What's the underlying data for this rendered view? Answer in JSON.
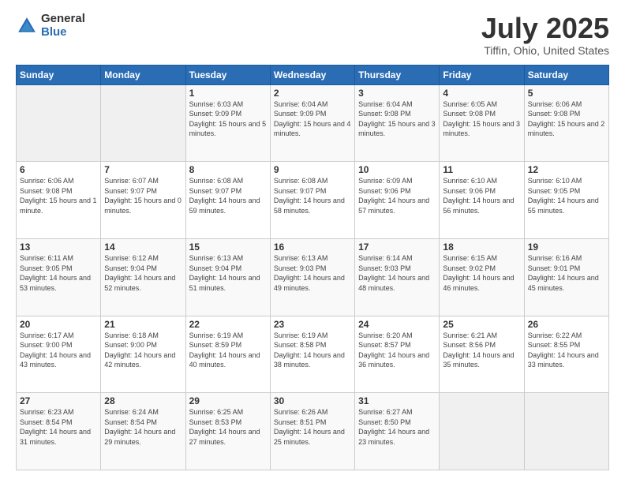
{
  "logo": {
    "general": "General",
    "blue": "Blue"
  },
  "title": "July 2025",
  "subtitle": "Tiffin, Ohio, United States",
  "days_of_week": [
    "Sunday",
    "Monday",
    "Tuesday",
    "Wednesday",
    "Thursday",
    "Friday",
    "Saturday"
  ],
  "weeks": [
    [
      {
        "day": "",
        "info": ""
      },
      {
        "day": "",
        "info": ""
      },
      {
        "day": "1",
        "info": "Sunrise: 6:03 AM\nSunset: 9:09 PM\nDaylight: 15 hours and 5 minutes."
      },
      {
        "day": "2",
        "info": "Sunrise: 6:04 AM\nSunset: 9:09 PM\nDaylight: 15 hours and 4 minutes."
      },
      {
        "day": "3",
        "info": "Sunrise: 6:04 AM\nSunset: 9:08 PM\nDaylight: 15 hours and 3 minutes."
      },
      {
        "day": "4",
        "info": "Sunrise: 6:05 AM\nSunset: 9:08 PM\nDaylight: 15 hours and 3 minutes."
      },
      {
        "day": "5",
        "info": "Sunrise: 6:06 AM\nSunset: 9:08 PM\nDaylight: 15 hours and 2 minutes."
      }
    ],
    [
      {
        "day": "6",
        "info": "Sunrise: 6:06 AM\nSunset: 9:08 PM\nDaylight: 15 hours and 1 minute."
      },
      {
        "day": "7",
        "info": "Sunrise: 6:07 AM\nSunset: 9:07 PM\nDaylight: 15 hours and 0 minutes."
      },
      {
        "day": "8",
        "info": "Sunrise: 6:08 AM\nSunset: 9:07 PM\nDaylight: 14 hours and 59 minutes."
      },
      {
        "day": "9",
        "info": "Sunrise: 6:08 AM\nSunset: 9:07 PM\nDaylight: 14 hours and 58 minutes."
      },
      {
        "day": "10",
        "info": "Sunrise: 6:09 AM\nSunset: 9:06 PM\nDaylight: 14 hours and 57 minutes."
      },
      {
        "day": "11",
        "info": "Sunrise: 6:10 AM\nSunset: 9:06 PM\nDaylight: 14 hours and 56 minutes."
      },
      {
        "day": "12",
        "info": "Sunrise: 6:10 AM\nSunset: 9:05 PM\nDaylight: 14 hours and 55 minutes."
      }
    ],
    [
      {
        "day": "13",
        "info": "Sunrise: 6:11 AM\nSunset: 9:05 PM\nDaylight: 14 hours and 53 minutes."
      },
      {
        "day": "14",
        "info": "Sunrise: 6:12 AM\nSunset: 9:04 PM\nDaylight: 14 hours and 52 minutes."
      },
      {
        "day": "15",
        "info": "Sunrise: 6:13 AM\nSunset: 9:04 PM\nDaylight: 14 hours and 51 minutes."
      },
      {
        "day": "16",
        "info": "Sunrise: 6:13 AM\nSunset: 9:03 PM\nDaylight: 14 hours and 49 minutes."
      },
      {
        "day": "17",
        "info": "Sunrise: 6:14 AM\nSunset: 9:03 PM\nDaylight: 14 hours and 48 minutes."
      },
      {
        "day": "18",
        "info": "Sunrise: 6:15 AM\nSunset: 9:02 PM\nDaylight: 14 hours and 46 minutes."
      },
      {
        "day": "19",
        "info": "Sunrise: 6:16 AM\nSunset: 9:01 PM\nDaylight: 14 hours and 45 minutes."
      }
    ],
    [
      {
        "day": "20",
        "info": "Sunrise: 6:17 AM\nSunset: 9:00 PM\nDaylight: 14 hours and 43 minutes."
      },
      {
        "day": "21",
        "info": "Sunrise: 6:18 AM\nSunset: 9:00 PM\nDaylight: 14 hours and 42 minutes."
      },
      {
        "day": "22",
        "info": "Sunrise: 6:19 AM\nSunset: 8:59 PM\nDaylight: 14 hours and 40 minutes."
      },
      {
        "day": "23",
        "info": "Sunrise: 6:19 AM\nSunset: 8:58 PM\nDaylight: 14 hours and 38 minutes."
      },
      {
        "day": "24",
        "info": "Sunrise: 6:20 AM\nSunset: 8:57 PM\nDaylight: 14 hours and 36 minutes."
      },
      {
        "day": "25",
        "info": "Sunrise: 6:21 AM\nSunset: 8:56 PM\nDaylight: 14 hours and 35 minutes."
      },
      {
        "day": "26",
        "info": "Sunrise: 6:22 AM\nSunset: 8:55 PM\nDaylight: 14 hours and 33 minutes."
      }
    ],
    [
      {
        "day": "27",
        "info": "Sunrise: 6:23 AM\nSunset: 8:54 PM\nDaylight: 14 hours and 31 minutes."
      },
      {
        "day": "28",
        "info": "Sunrise: 6:24 AM\nSunset: 8:54 PM\nDaylight: 14 hours and 29 minutes."
      },
      {
        "day": "29",
        "info": "Sunrise: 6:25 AM\nSunset: 8:53 PM\nDaylight: 14 hours and 27 minutes."
      },
      {
        "day": "30",
        "info": "Sunrise: 6:26 AM\nSunset: 8:51 PM\nDaylight: 14 hours and 25 minutes."
      },
      {
        "day": "31",
        "info": "Sunrise: 6:27 AM\nSunset: 8:50 PM\nDaylight: 14 hours and 23 minutes."
      },
      {
        "day": "",
        "info": ""
      },
      {
        "day": "",
        "info": ""
      }
    ]
  ]
}
